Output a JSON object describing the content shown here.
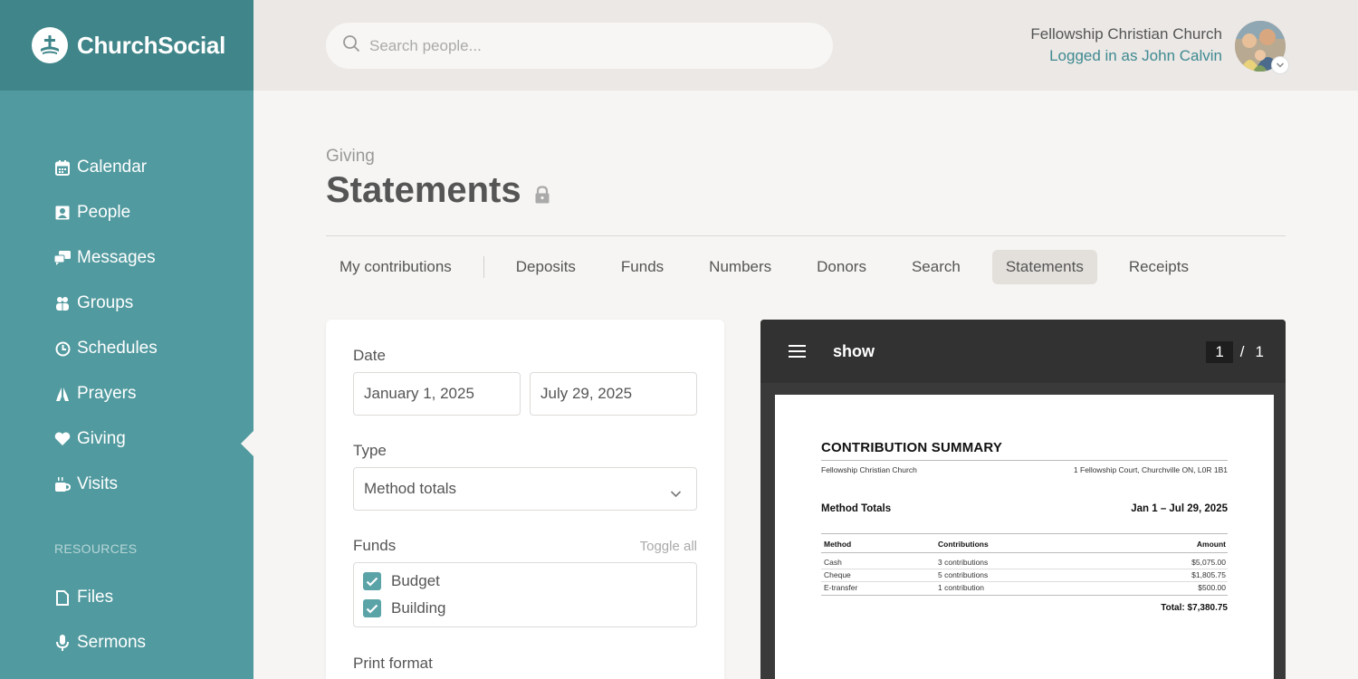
{
  "brand": {
    "name": "ChurchSocial",
    "logo_icon": "church-logo-icon"
  },
  "sidebar": {
    "items": [
      {
        "label": "Calendar",
        "icon": "calendar-icon"
      },
      {
        "label": "People",
        "icon": "people-icon"
      },
      {
        "label": "Messages",
        "icon": "messages-icon"
      },
      {
        "label": "Groups",
        "icon": "groups-icon"
      },
      {
        "label": "Schedules",
        "icon": "clock-icon"
      },
      {
        "label": "Prayers",
        "icon": "prayer-hands-icon"
      },
      {
        "label": "Giving",
        "icon": "heart-icon",
        "active": true
      },
      {
        "label": "Visits",
        "icon": "coffee-cup-icon"
      }
    ],
    "resources_heading": "RESOURCES",
    "resources": [
      {
        "label": "Files",
        "icon": "file-icon"
      },
      {
        "label": "Sermons",
        "icon": "microphone-icon"
      }
    ]
  },
  "header": {
    "search_placeholder": "Search people...",
    "org_name": "Fellowship Christian Church",
    "login_text": "Logged in as John Calvin"
  },
  "page": {
    "breadcrumb": "Giving",
    "title": "Statements"
  },
  "tabs": [
    {
      "label": "My contributions"
    },
    {
      "label": "Deposits"
    },
    {
      "label": "Funds"
    },
    {
      "label": "Numbers"
    },
    {
      "label": "Donors"
    },
    {
      "label": "Search"
    },
    {
      "label": "Statements",
      "active": true
    },
    {
      "label": "Receipts"
    }
  ],
  "form": {
    "date_label": "Date",
    "date_from": "January 1, 2025",
    "date_to": "July 29, 2025",
    "type_label": "Type",
    "type_value": "Method totals",
    "funds_label": "Funds",
    "toggle_all": "Toggle all",
    "funds": [
      {
        "label": "Budget",
        "checked": true
      },
      {
        "label": "Building",
        "checked": true
      }
    ],
    "print_format_label": "Print format"
  },
  "viewer": {
    "doc_name": "show",
    "current_page": "1",
    "page_sep": "/",
    "total_pages": "1",
    "document": {
      "title": "CONTRIBUTION SUMMARY",
      "church": "Fellowship Christian Church",
      "address": "1 Fellowship Court, Churchville ON, L0R 1B1",
      "section_title": "Method Totals",
      "date_range": "Jan 1 – Jul 29, 2025",
      "columns": [
        "Method",
        "Contributions",
        "Amount"
      ],
      "rows": [
        [
          "Cash",
          "3 contributions",
          "$5,075.00"
        ],
        [
          "Cheque",
          "5 contributions",
          "$1,805.75"
        ],
        [
          "E-transfer",
          "1 contribution",
          "$500.00"
        ]
      ],
      "total": "Total: $7,380.75"
    }
  },
  "colors": {
    "sidebar": "#519a9f",
    "brand_bar": "#3f8589",
    "accent": "#3f8a90"
  }
}
